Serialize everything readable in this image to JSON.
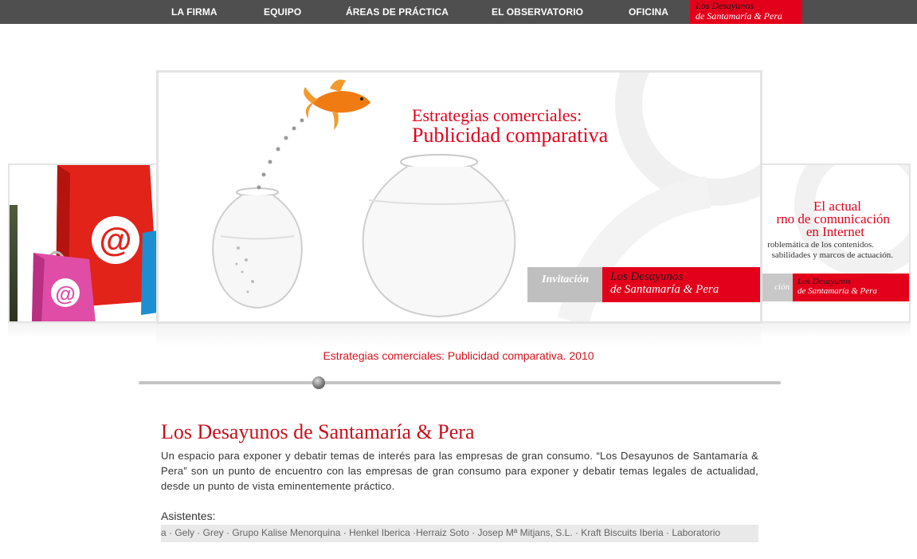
{
  "nav": {
    "items": [
      {
        "label": "LA FIRMA"
      },
      {
        "label": "EQUIPO"
      },
      {
        "label": "ÁREAS DE PRÁCTICA"
      },
      {
        "label": "EL OBSERVATORIO"
      },
      {
        "label": "OFICINA"
      }
    ],
    "logo_line1": "Los Desayunos",
    "logo_line2": "de Santamaría & Pera"
  },
  "carousel": {
    "main_slide": {
      "title_line1": "Estrategias comerciales:",
      "title_line2": "Publicidad comparativa",
      "invitation": "Invitación",
      "logo_line1": "Los Desayunos",
      "logo_line2": "de Santamaría & Pera"
    },
    "right_slide": {
      "title_line1": "El actual",
      "title_line2": "rno de comunicación",
      "title_line3": "en Internet",
      "sub_line1": "roblemática de los contenidos.",
      "sub_line2": "sabilidades y marcos de actuación.",
      "invitation": "ción",
      "logo_line1": "Los Desayunos",
      "logo_line2": "de Santamaría & Pera"
    },
    "caption": "Estrategias comerciales: Publicidad comparativa. 2010",
    "slider_position": 0.28
  },
  "content": {
    "title": "Los Desayunos de Santamaría & Pera",
    "description": "Un espacio para exponer y debatir temas de interés para las empresas de gran consumo. “Los Desayunos de Santamaría & Pera” son un punto de encuentro con las empresas de gran consumo para exponer y debatir temas legales de actualidad, desde un punto de vista eminentemente práctico.",
    "attendees_label": "Asistentes:",
    "attendees_ticker": "a · Gely · Grey · Grupo Kalise Menorquina · Henkel Iberica ·Herraiz Soto · Josep Mª Mitjans, S.L. · Kraft Biscuits Iberia · Laboratorio"
  },
  "colors": {
    "brand_red": "#e3001b",
    "nav_bg": "#4f4f4f"
  }
}
